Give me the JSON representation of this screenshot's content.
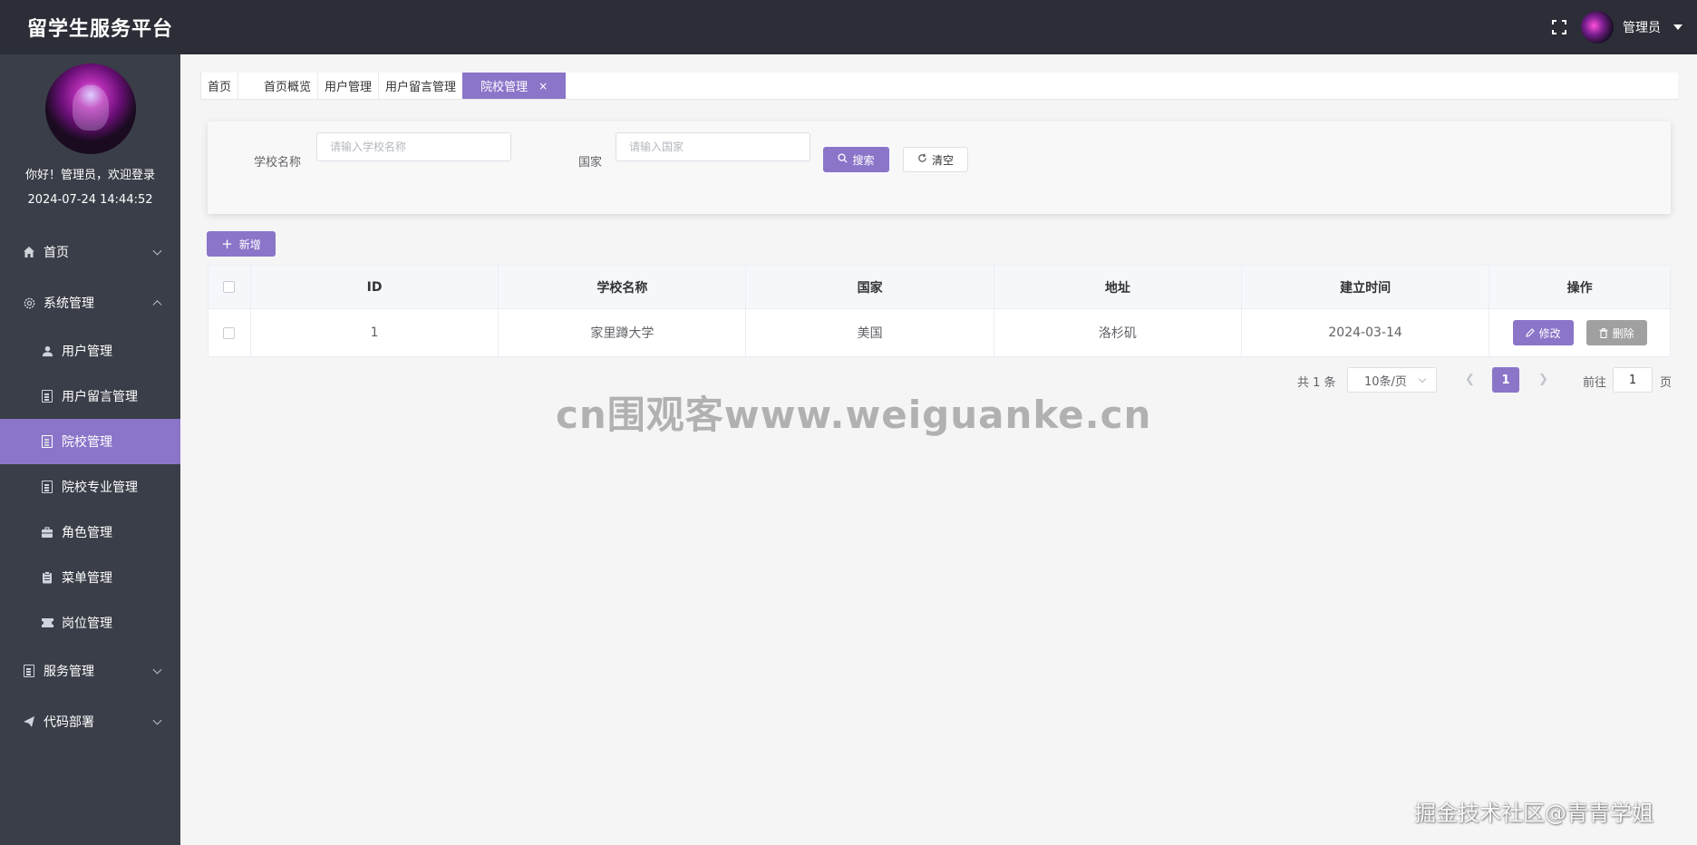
{
  "header": {
    "brand": "留学生服务平台",
    "user_name": "管理员"
  },
  "sidebar": {
    "greeting": "你好！管理员，欢迎登录",
    "datetime": "2024-07-24 14:44:52",
    "menu": [
      {
        "label": "首页",
        "icon": "home-icon",
        "expanded": false
      },
      {
        "label": "系统管理",
        "icon": "gear-icon",
        "expanded": true,
        "children": [
          {
            "label": "用户管理",
            "icon": "user-icon",
            "active": false
          },
          {
            "label": "用户留言管理",
            "icon": "document-icon",
            "active": false
          },
          {
            "label": "院校管理",
            "icon": "document-icon",
            "active": true
          },
          {
            "label": "院校专业管理",
            "icon": "document-icon",
            "active": false
          },
          {
            "label": "角色管理",
            "icon": "briefcase-icon",
            "active": false
          },
          {
            "label": "菜单管理",
            "icon": "clipboard-icon",
            "active": false
          },
          {
            "label": "岗位管理",
            "icon": "ticket-icon",
            "active": false
          }
        ]
      },
      {
        "label": "服务管理",
        "icon": "document-icon",
        "expanded": false
      },
      {
        "label": "代码部署",
        "icon": "send-icon",
        "expanded": false
      }
    ]
  },
  "tabs": [
    {
      "label": "首页",
      "active": false
    },
    {
      "label": "首页概览",
      "active": false
    },
    {
      "label": "用户管理",
      "active": false
    },
    {
      "label": "用户留言管理",
      "active": false
    },
    {
      "label": "院校管理",
      "active": true,
      "close": "×"
    }
  ],
  "search": {
    "school_label": "学校名称",
    "school_placeholder": "请输入学校名称",
    "country_label": "国家",
    "country_placeholder": "请输入国家",
    "search_button": "搜索",
    "clear_button": "清空"
  },
  "toolbar": {
    "add_button": "新增"
  },
  "table": {
    "columns": [
      "ID",
      "学校名称",
      "国家",
      "地址",
      "建立时间",
      "操作"
    ],
    "rows": [
      {
        "id": "1",
        "name": "家里蹲大学",
        "country": "美国",
        "address": "洛杉矶",
        "founded": "2024-03-14"
      }
    ],
    "edit_button": "修改",
    "delete_button": "删除"
  },
  "pagination": {
    "total": "共 1 条",
    "page_size": "10条/页",
    "current_page": "1",
    "goto_label": "前往",
    "goto_value": "1",
    "page_suffix": "页"
  },
  "watermark": "cn围观客www.weiguanke.cn",
  "corner_watermark": "掘金技术社区@青青学姐",
  "colors": {
    "accent": "#8b75c9",
    "sidebar": "#3a3e48",
    "header": "#2b2e36"
  }
}
